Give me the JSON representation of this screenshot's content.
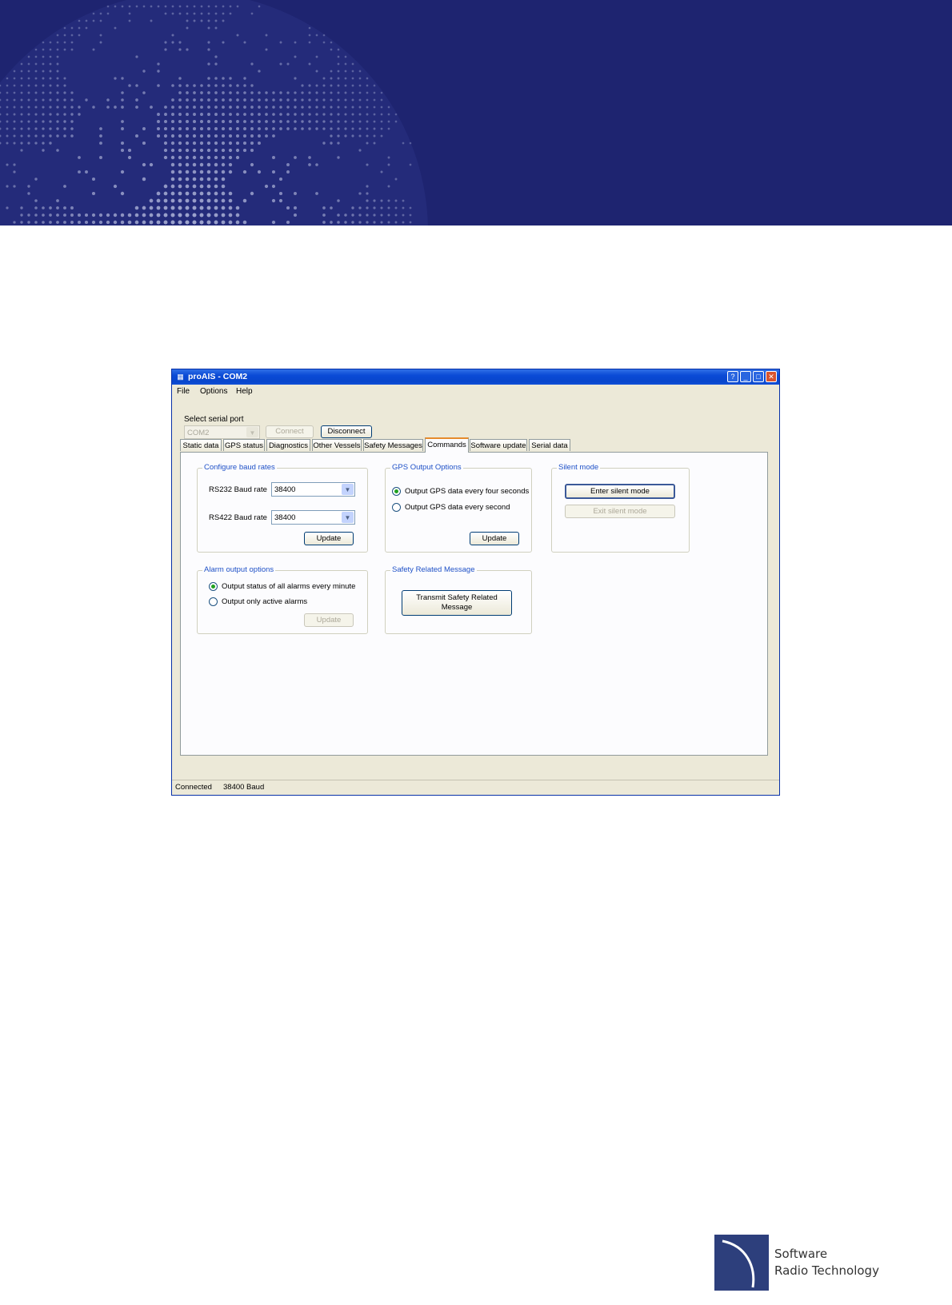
{
  "window": {
    "title": "proAIS - COM2",
    "app_icon": "ais-app-icon",
    "controls": [
      "help-icon",
      "minimize-icon",
      "maximize-icon",
      "close-icon"
    ]
  },
  "menu": {
    "file": "File",
    "options": "Options",
    "help": "Help"
  },
  "serial": {
    "label": "Select serial port",
    "port_value": "COM2",
    "connect": "Connect",
    "disconnect": "Disconnect"
  },
  "tabs": [
    "Static data",
    "GPS status",
    "Diagnostics",
    "Other Vessels",
    "Safety Messages",
    "Commands",
    "Software update",
    "Serial data"
  ],
  "active_tab": "Commands",
  "baud": {
    "title": "Configure baud rates",
    "rs232_label": "RS232 Baud rate",
    "rs232_value": "38400",
    "rs422_label": "RS422 Baud rate",
    "rs422_value": "38400",
    "update": "Update"
  },
  "gps": {
    "title": "GPS Output Options",
    "option1": "Output GPS data every four seconds",
    "option2": "Output GPS data every second",
    "selected": 1,
    "update": "Update"
  },
  "silent": {
    "title": "Silent mode",
    "enter": "Enter silent mode",
    "exit": "Exit silent mode"
  },
  "alarm": {
    "title": "Alarm output options",
    "option1": "Output status of all alarms every minute",
    "option2": "Output only active alarms",
    "selected": 1,
    "update": "Update"
  },
  "safety": {
    "title": "Safety Related Message",
    "button_line1": "Transmit Safety Related",
    "button_line2": "Message"
  },
  "status": {
    "connection": "Connected",
    "baud": "38400 Baud"
  },
  "logo": {
    "line1": "Software",
    "line2": "Radio Technology"
  },
  "colors": {
    "banner": "#1e2470",
    "titlebar": "#0a4ad6",
    "group_title": "#1f51c7",
    "active_tab_accent": "#e68b2c"
  }
}
